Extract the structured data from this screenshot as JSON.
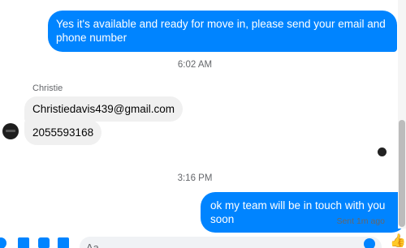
{
  "messages": {
    "outgoing_1": "Yes it's available and ready for move in, please send your email and phone number",
    "incoming_1": "Christiedavis439@gmail.com",
    "incoming_2": "2055593168",
    "outgoing_2": "ok my team will be in touch with you soon"
  },
  "timestamps": {
    "first": "6:02 AM",
    "second": "3:16 PM"
  },
  "sender": {
    "name": "Christie"
  },
  "status": {
    "delivery": "Sent 1m ago"
  },
  "composer": {
    "placeholder": "Aa",
    "icons": [
      "plus-icon",
      "image-icon",
      "sticker-icon",
      "gif-icon",
      "emoji-icon",
      "thumbs-up-icon"
    ]
  },
  "colors": {
    "accent": "#0084ff",
    "incoming_bubble": "#f0f0f0",
    "muted_text": "#65676b"
  }
}
